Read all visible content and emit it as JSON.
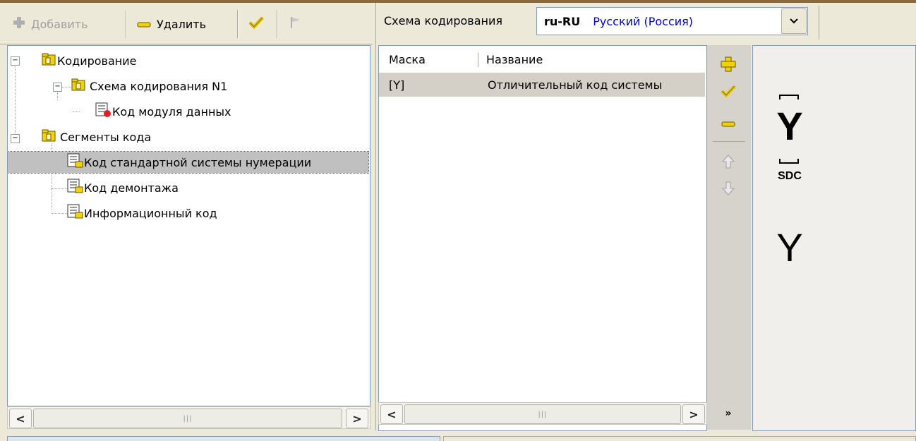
{
  "toolbar": {
    "add_label": "Добавить",
    "delete_label": "Удалить"
  },
  "tree": {
    "nodes": [
      {
        "label": "Кодирование"
      },
      {
        "label": "Схема кодирования N1"
      },
      {
        "label": "Код модуля данных"
      },
      {
        "label": "Сегменты кода"
      },
      {
        "label": "Код стандартной системы нумерации"
      },
      {
        "label": "Код демонтажа"
      },
      {
        "label": "Информационный код"
      }
    ]
  },
  "scheme": {
    "label": "Схема кодирования",
    "code": "ru-RU",
    "name": "Русский (Россия)"
  },
  "list": {
    "columns": [
      "Маска",
      "Название"
    ],
    "rows": [
      {
        "mask": "[Y]",
        "name": "Отличительный код системы"
      }
    ]
  },
  "preview": {
    "letter_top": "Y",
    "caption": "SDC",
    "letter_bottom": "Y"
  },
  "colors": {
    "accent_line": "#8a6a3a",
    "selection": "#c0c0c0",
    "scheme_name": "#0000cc",
    "icon_yellow": "#e8c800"
  },
  "icons": [
    "plus-icon",
    "minus-icon",
    "checkmark-icon",
    "flag-icon",
    "folder-icon",
    "document-icon",
    "arrow-up-icon",
    "arrow-down-icon",
    "more-icon",
    "chevron-down-icon"
  ]
}
